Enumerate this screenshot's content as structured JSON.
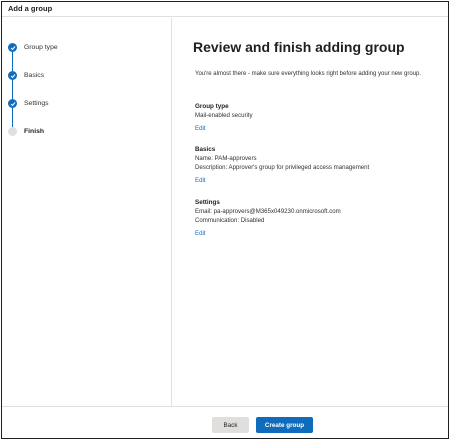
{
  "window": {
    "title": "Add a group"
  },
  "steps": [
    {
      "label": "Group type",
      "status": "done"
    },
    {
      "label": "Basics",
      "status": "done"
    },
    {
      "label": "Settings",
      "status": "done"
    },
    {
      "label": "Finish",
      "status": "current"
    }
  ],
  "main": {
    "title": "Review and finish adding group",
    "intro": "You're almost there - make sure everything looks right before adding your new group.",
    "sections": [
      {
        "heading": "Group type",
        "lines": [
          "Mail-enabled security"
        ],
        "edit_label": "Edit"
      },
      {
        "heading": "Basics",
        "lines": [
          "Name: PAM-approvers",
          "Description: Approver's group for privileged access management"
        ],
        "edit_label": "Edit"
      },
      {
        "heading": "Settings",
        "lines": [
          "Email: pa-approvers@M365x049230.onmicrosoft.com",
          "Communication: Disabled"
        ],
        "edit_label": "Edit"
      }
    ]
  },
  "footer": {
    "back_label": "Back",
    "create_label": "Create group"
  },
  "colors": {
    "accent": "#0f6cbd",
    "pending": "#e1dfdd",
    "border": "#e1dfdd"
  }
}
